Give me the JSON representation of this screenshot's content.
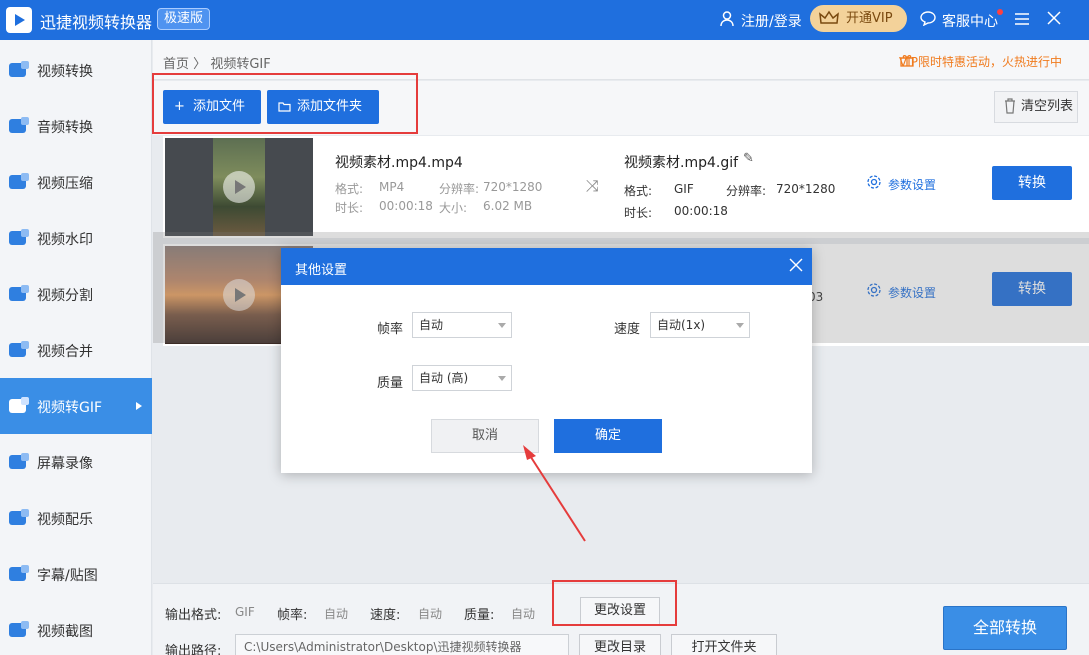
{
  "app": {
    "title": "迅捷视频转换器",
    "badge": "极速版",
    "login": "注册/登录",
    "vip": "开通VIP",
    "service": "客服中心"
  },
  "sidebar": {
    "items": [
      {
        "label": "视频转换",
        "icon": "video-convert-icon"
      },
      {
        "label": "音频转换",
        "icon": "audio-convert-icon"
      },
      {
        "label": "视频压缩",
        "icon": "video-compress-icon"
      },
      {
        "label": "视频水印",
        "icon": "video-watermark-icon"
      },
      {
        "label": "视频分割",
        "icon": "video-split-icon"
      },
      {
        "label": "视频合并",
        "icon": "video-merge-icon"
      },
      {
        "label": "视频转GIF",
        "icon": "video-gif-icon"
      },
      {
        "label": "屏幕录像",
        "icon": "screen-record-icon"
      },
      {
        "label": "视频配乐",
        "icon": "video-music-icon"
      },
      {
        "label": "字幕/贴图",
        "icon": "subtitle-sticker-icon"
      },
      {
        "label": "视频截图",
        "icon": "video-screenshot-icon"
      }
    ],
    "active": 6
  },
  "breadcrumb": {
    "home": "首页",
    "sep": "〉",
    "current": "视频转GIF"
  },
  "promo": "VIP限时特惠活动，火热进行中",
  "toolbar": {
    "add_file": "添加文件",
    "add_folder": "添加文件夹",
    "clear": "清空列表"
  },
  "files": [
    {
      "name": "视频素材.mp4.mp4",
      "format_label": "格式:",
      "format": "MP4",
      "res_label": "分辨率:",
      "res": "720*1280",
      "dur_label": "时长:",
      "duration": "00:00:18",
      "size_label": "大小:",
      "size": "6.02 MB",
      "out_name": "视频素材.mp4.gif",
      "out_format": "GIF",
      "out_res": "720*1280",
      "out_duration": "00:00:18",
      "param": "参数设置",
      "convert": "转换"
    },
    {
      "name": "",
      "param": "参数设置",
      "convert": "转换",
      "partial": "03"
    }
  ],
  "dialog": {
    "title": "其他设置",
    "fps_label": "帧率",
    "fps": "自动",
    "speed_label": "速度",
    "speed": "自动(1x)",
    "quality_label": "质量",
    "quality": "自动 (高)",
    "cancel": "取消",
    "ok": "确定"
  },
  "bottom": {
    "format_label": "输出格式:",
    "format": "GIF",
    "fps_label": "帧率:",
    "fps": "自动",
    "speed_label": "速度:",
    "speed": "自动",
    "quality_label": "质量:",
    "quality": "自动",
    "change_settings": "更改设置",
    "path_label": "输出路径:",
    "path": "C:\\Users\\Administrator\\Desktop\\迅捷视频转换器",
    "change_dir": "更改目录",
    "open_folder": "打开文件夹",
    "convert_all": "全部转换"
  }
}
